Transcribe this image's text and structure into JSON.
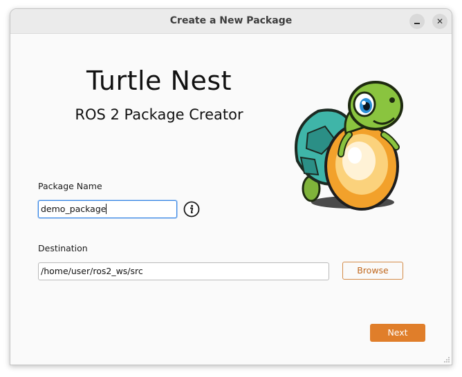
{
  "window": {
    "title": "Create a New Package",
    "minimize_icon": "minimize-icon",
    "close_icon": "close-icon",
    "close_glyph": "✕"
  },
  "header": {
    "title": "Turtle Nest",
    "subtitle": "ROS 2 Package Creator",
    "logo": "turtle-on-egg-logo"
  },
  "form": {
    "package_name": {
      "label": "Package Name",
      "value": "demo_package",
      "info_icon": "info-icon"
    },
    "destination": {
      "label": "Destination",
      "value": "/home/user/ros2_ws/src",
      "browse_label": "Browse"
    }
  },
  "footer": {
    "next_label": "Next"
  },
  "colors": {
    "accent": "#e07e2a",
    "focus": "#3584e4",
    "titlebar": "#ebebeb",
    "background": "#fafafa"
  }
}
